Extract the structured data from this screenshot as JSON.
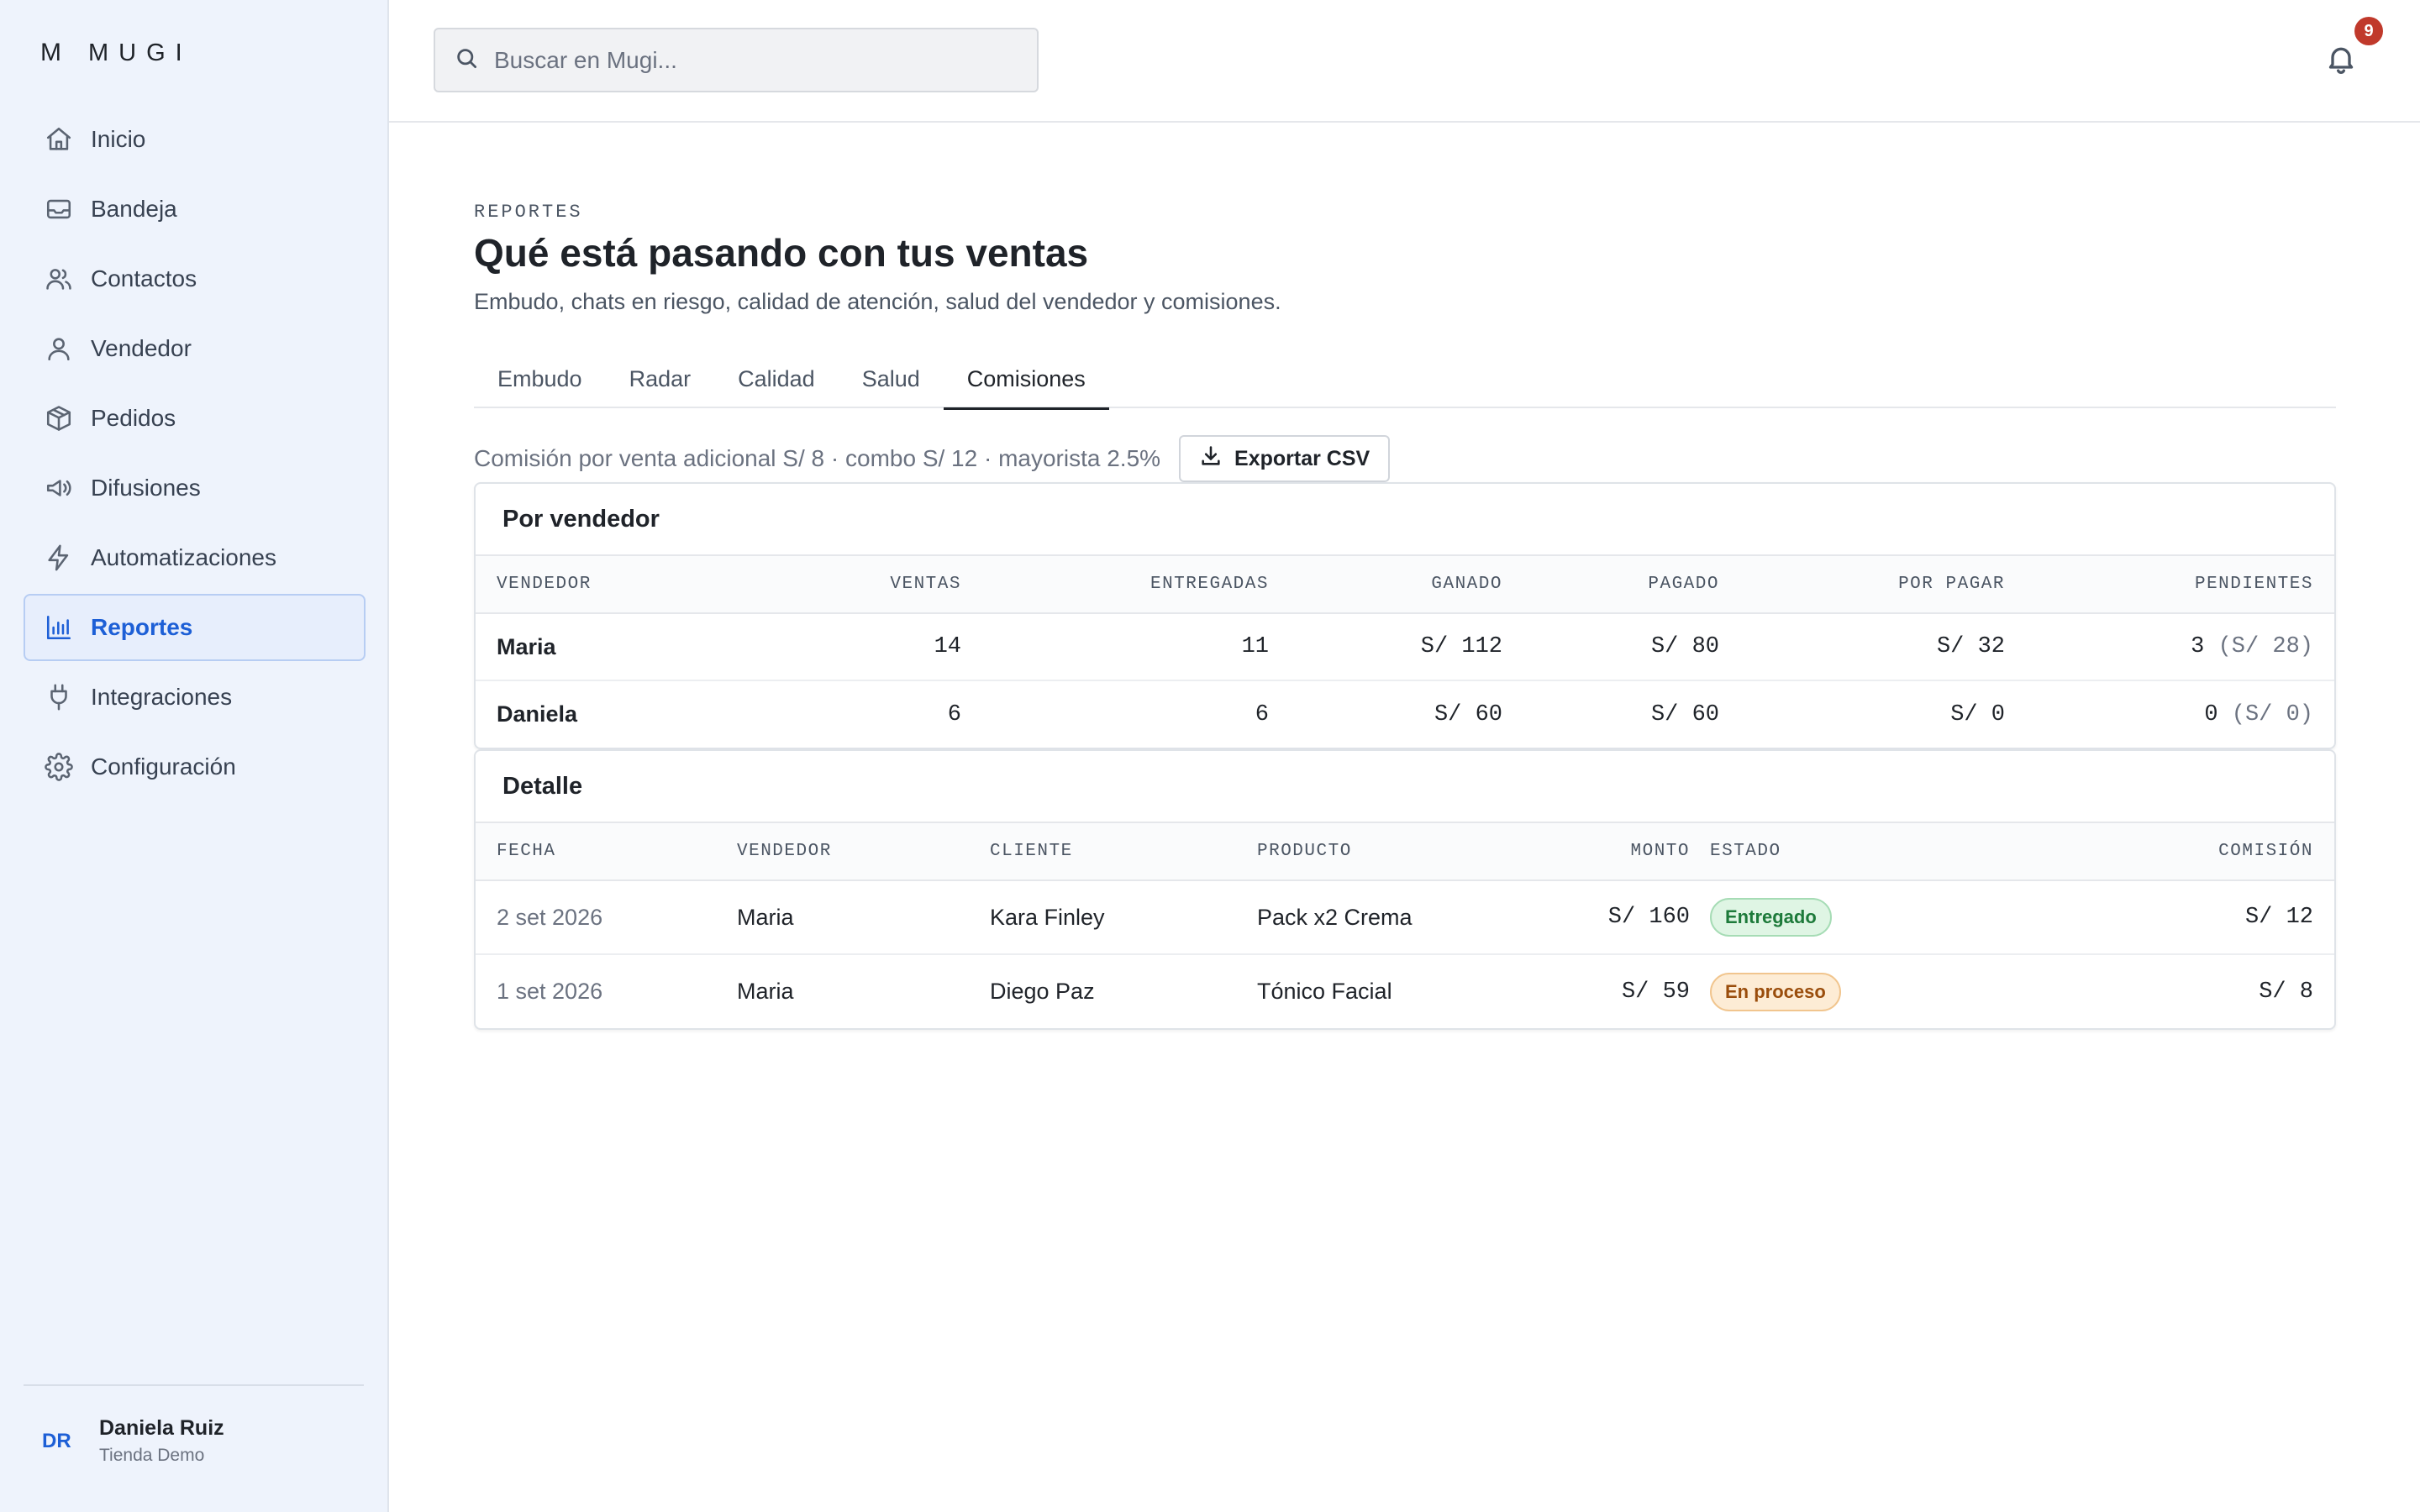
{
  "app": {
    "logo_mark": "M",
    "logo_name": "MUGI"
  },
  "sidebar": {
    "items": [
      {
        "label": "Inicio",
        "icon": "home-icon"
      },
      {
        "label": "Bandeja",
        "icon": "inbox-icon"
      },
      {
        "label": "Contactos",
        "icon": "users-icon"
      },
      {
        "label": "Vendedor",
        "icon": "user-icon"
      },
      {
        "label": "Pedidos",
        "icon": "package-icon"
      },
      {
        "label": "Difusiones",
        "icon": "megaphone-icon"
      },
      {
        "label": "Automatizaciones",
        "icon": "bolt-icon"
      },
      {
        "label": "Reportes",
        "icon": "bar-chart-icon",
        "active": true
      },
      {
        "label": "Integraciones",
        "icon": "plug-icon"
      },
      {
        "label": "Configuración",
        "icon": "gear-icon"
      }
    ],
    "user": {
      "initials": "DR",
      "name": "Daniela Ruiz",
      "store": "Tienda Demo"
    }
  },
  "header": {
    "search_placeholder": "Buscar en Mugi...",
    "notifications_count": "9"
  },
  "page": {
    "eyebrow": "REPORTES",
    "title": "Qué está pasando con tus ventas",
    "subtitle": "Embudo, chats en riesgo, calidad de atención, salud del vendedor y comisiones.",
    "tabs": [
      {
        "label": "Embudo"
      },
      {
        "label": "Radar"
      },
      {
        "label": "Calidad"
      },
      {
        "label": "Salud"
      },
      {
        "label": "Comisiones",
        "active": true
      }
    ],
    "commission_note": "Comisión por venta adicional S/ 8 · combo S/ 12 · mayorista 2.5%",
    "export_label": "Exportar CSV"
  },
  "by_seller": {
    "title": "Por vendedor",
    "columns": [
      "VENDEDOR",
      "VENTAS",
      "ENTREGADAS",
      "GANADO",
      "PAGADO",
      "POR PAGAR",
      "PENDIENTES"
    ],
    "rows": [
      {
        "seller": "Maria",
        "sales": "14",
        "delivered": "11",
        "earned": "S/ 112",
        "paid": "S/ 80",
        "to_pay": "S/ 32",
        "pending": "3",
        "pending_amount": "(S/ 28)"
      },
      {
        "seller": "Daniela",
        "sales": "6",
        "delivered": "6",
        "earned": "S/ 60",
        "paid": "S/ 60",
        "to_pay": "S/ 0",
        "pending": "0",
        "pending_amount": "(S/ 0)"
      }
    ]
  },
  "detail": {
    "title": "Detalle",
    "columns": [
      "FECHA",
      "VENDEDOR",
      "CLIENTE",
      "PRODUCTO",
      "MONTO",
      "ESTADO",
      "COMISIÓN"
    ],
    "rows": [
      {
        "date": "2 set 2026",
        "seller": "Maria",
        "client": "Kara Finley",
        "product": "Pack x2 Crema",
        "amount": "S/ 160",
        "status": "Entregado",
        "status_color": "#1d7a3a",
        "commission": "S/ 12"
      },
      {
        "date": "1 set 2026",
        "seller": "Maria",
        "client": "Diego Paz",
        "product": "Tónico Facial",
        "amount": "S/ 59",
        "status": "En proceso",
        "status_color": "#9a4d0c",
        "commission": "S/ 8"
      }
    ]
  },
  "colors": {
    "accent": "#1d5fd6",
    "sidebar_bg": "#eef3fc",
    "badge": "#c0392b"
  }
}
